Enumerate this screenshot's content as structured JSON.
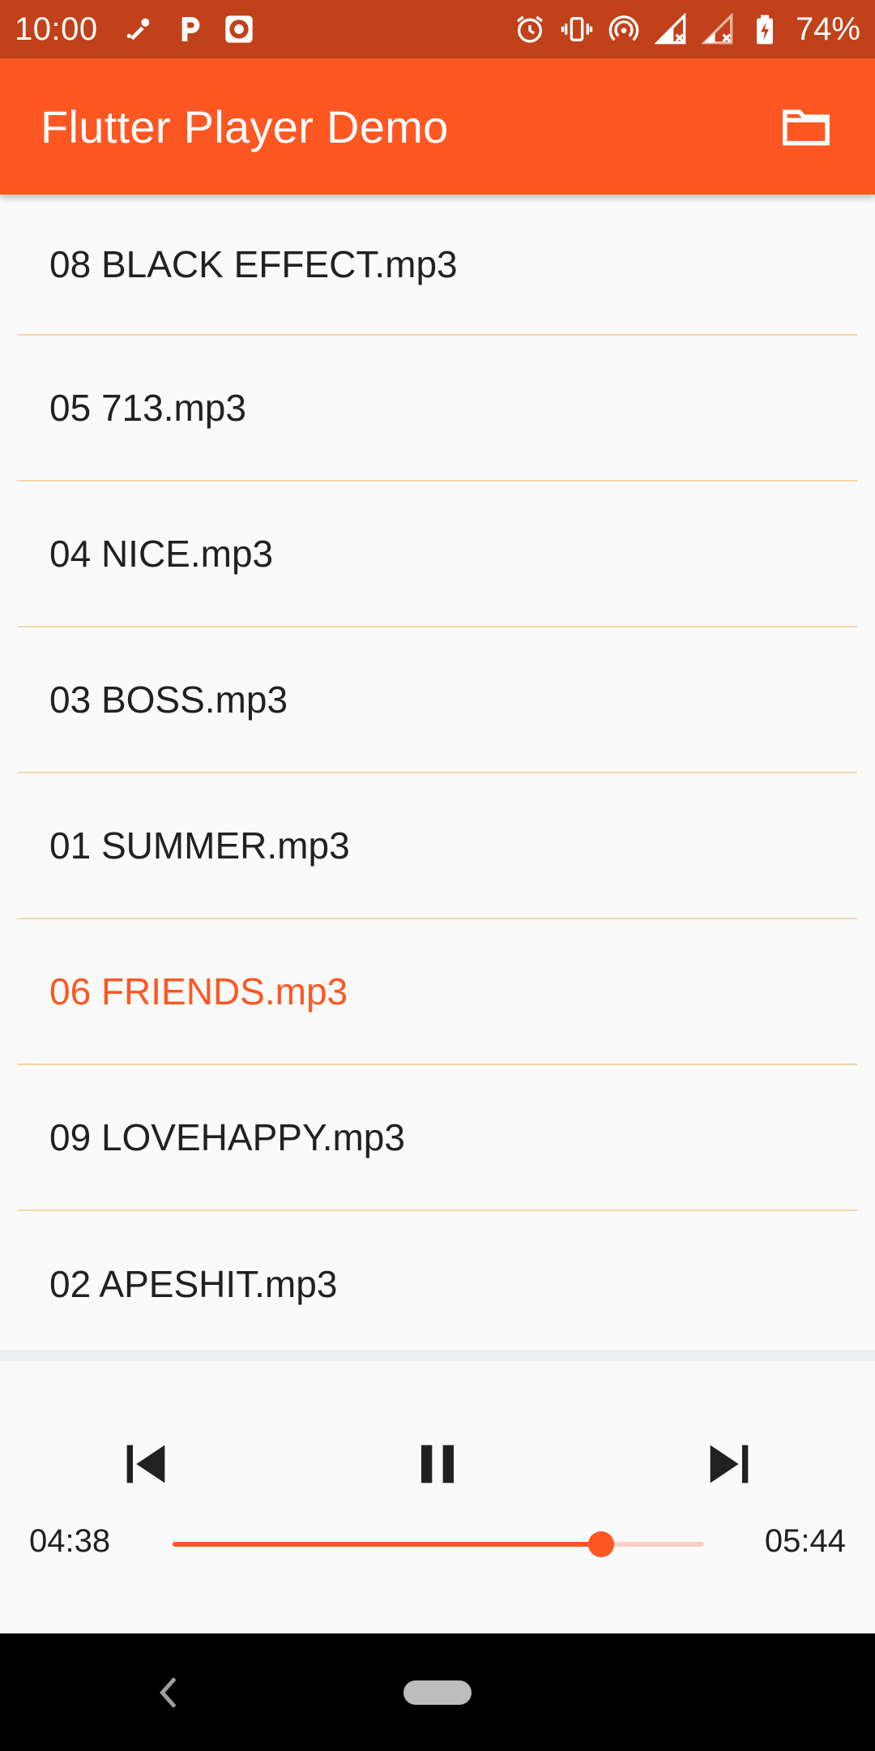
{
  "status_bar": {
    "time": "10:00",
    "battery_text": "74%",
    "left_icons": [
      "wrench-icon",
      "p-app-icon",
      "record-app-icon"
    ],
    "right_icons": [
      "alarm-icon",
      "vibrate-icon",
      "hotspot-icon",
      "signal-no-data-icon",
      "signal-no-data-2-icon",
      "battery-charging-icon"
    ],
    "background": "#c1411a"
  },
  "app_bar": {
    "title": "Flutter Player Demo",
    "action_icon": "folder-icon",
    "background": "#ff5722"
  },
  "tracks": [
    {
      "label": "08 BLACK EFFECT.mp3",
      "active": false
    },
    {
      "label": "05 713.mp3",
      "active": false
    },
    {
      "label": "04 NICE.mp3",
      "active": false
    },
    {
      "label": "03 BOSS.mp3",
      "active": false
    },
    {
      "label": "01 SUMMER.mp3",
      "active": false
    },
    {
      "label": "06 FRIENDS.mp3",
      "active": true
    },
    {
      "label": "09 LOVEHAPPY.mp3",
      "active": false
    },
    {
      "label": "02 APESHIT.mp3",
      "active": false
    }
  ],
  "player": {
    "prev_icon": "skip-previous-icon",
    "play_state_icon": "pause-icon",
    "next_icon": "skip-next-icon",
    "elapsed": "04:38",
    "duration": "05:44",
    "progress": 0.807,
    "accent": "#ff5722"
  },
  "nav_bar": {
    "back_icon": "back-chevron-icon",
    "home_icon": "home-pill-icon"
  }
}
